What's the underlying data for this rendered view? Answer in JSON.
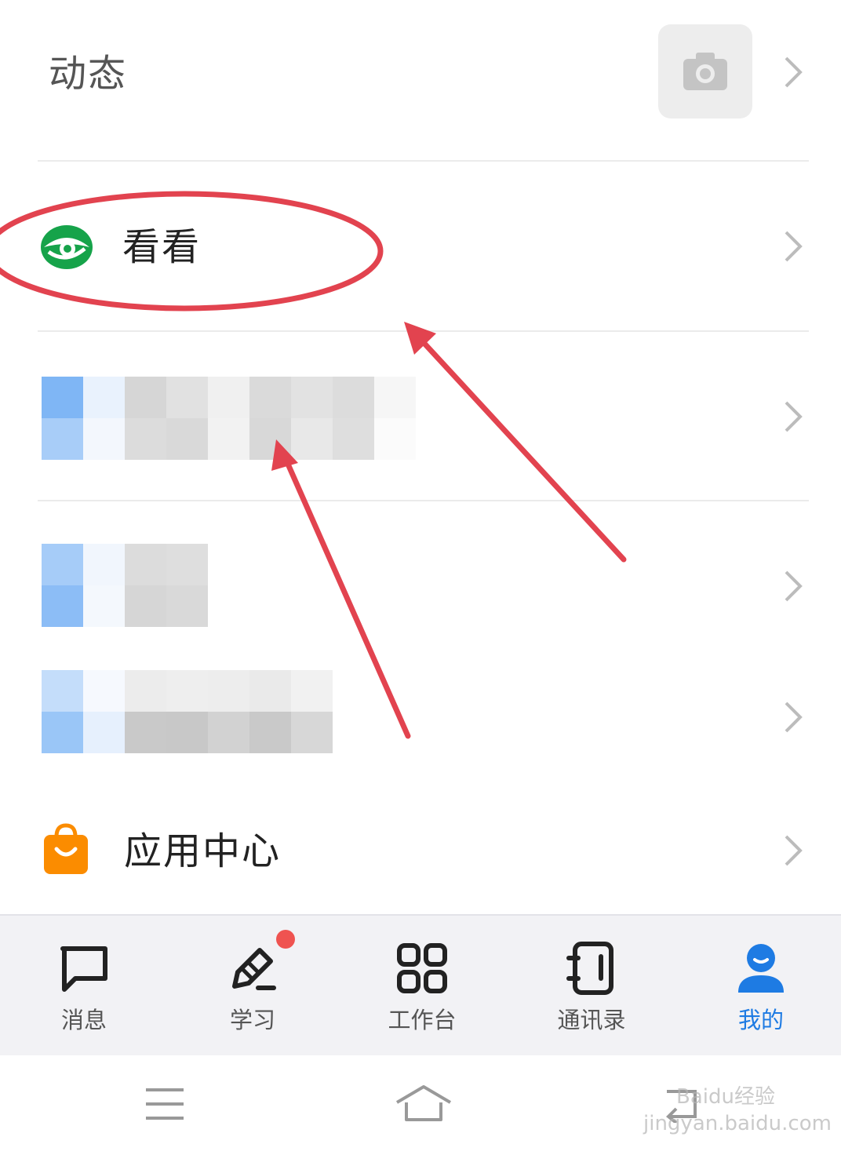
{
  "rows": {
    "dongtai": {
      "label": "动态",
      "camera_icon": "camera-icon"
    },
    "kankan": {
      "label": "看看",
      "icon": "eye-icon",
      "icon_color": "#16a34a"
    },
    "app_center": {
      "label": "应用中心",
      "icon": "shopping-bag-icon",
      "icon_color": "#fb8c00"
    }
  },
  "tabbar": {
    "items": [
      {
        "label": "消息",
        "icon": "message-icon"
      },
      {
        "label": "学习",
        "icon": "pencil-icon",
        "badge": true
      },
      {
        "label": "工作台",
        "icon": "grid-icon"
      },
      {
        "label": "通讯录",
        "icon": "contacts-icon"
      },
      {
        "label": "我的",
        "icon": "user-icon",
        "active": true
      }
    ],
    "active_color": "#1e7be3"
  },
  "system_nav": {
    "buttons": [
      "menu-icon",
      "home-icon",
      "back-icon"
    ]
  },
  "watermark": "Baidu经验 jingyan.baidu.com",
  "annotation_color": "#e2434f"
}
